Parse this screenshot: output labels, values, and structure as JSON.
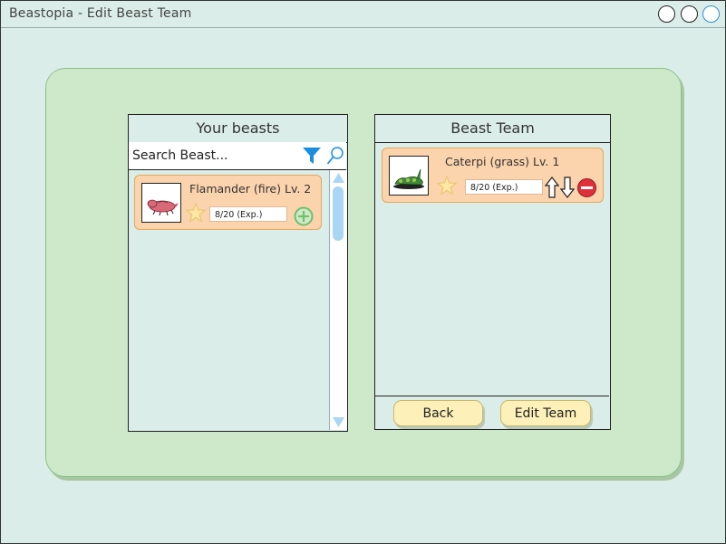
{
  "window": {
    "title": "Beastopia - Edit Beast Team"
  },
  "your_beasts": {
    "title": "Your beasts",
    "search": {
      "placeholder": "Search Beast...",
      "value": ""
    },
    "beasts": [
      {
        "name": "Flamander (fire) Lv. 2",
        "exp": "8/20 (Exp.)",
        "icon": "beast-sprite-flamander"
      }
    ]
  },
  "beast_team": {
    "title": "Beast Team",
    "beasts": [
      {
        "name": "Caterpi (grass) Lv. 1",
        "exp": "8/20 (Exp.)",
        "icon": "beast-sprite-caterpi"
      }
    ],
    "buttons": {
      "back": "Back",
      "edit_team": "Edit Team"
    }
  },
  "colors": {
    "background": "#dbede8",
    "main_panel": "#cde9c9",
    "card": "#fbd3ac",
    "button": "#fdf0b8",
    "filter": "#1a8fe0",
    "add": "#6fbf6f",
    "remove": "#e0303a"
  }
}
